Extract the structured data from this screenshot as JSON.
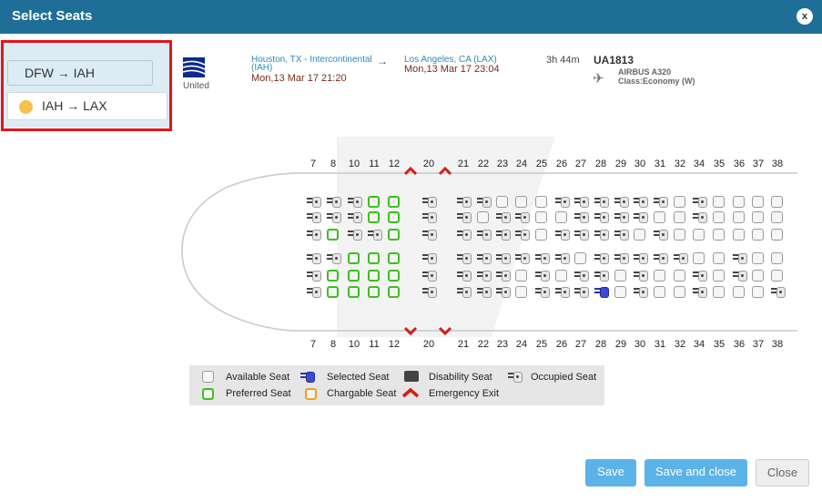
{
  "dialog": {
    "title": "Select Seats",
    "close_label": "x"
  },
  "legs": [
    {
      "label": "DFW → IAH"
    },
    {
      "label": "IAH → LAX"
    }
  ],
  "flight": {
    "airline": "United",
    "origin_city": "Houston, TX - Intercontinental",
    "origin_code": "(IAH)",
    "depart_time": "Mon,13 Mar 17 21:20",
    "arrow": "→",
    "dest_city": "Los Angeles, CA (LAX)",
    "arrive_time": "Mon,13 Mar 17 23:04",
    "duration": "3h 44m",
    "flight_number": "UA1813",
    "aircraft": "AIRBUS A320",
    "class": "Class:Economy (W)"
  },
  "rows": [
    "7",
    "8",
    "10",
    "11",
    "12",
    "20",
    "21",
    "22",
    "23",
    "24",
    "25",
    "26",
    "27",
    "28",
    "29",
    "30",
    "31",
    "32",
    "34",
    "35",
    "36",
    "37",
    "38"
  ],
  "legend": {
    "available": "Available Seat",
    "selected": "Selected Seat",
    "disability": "Disability Seat",
    "occupied": "Occupied Seat",
    "preferred": "Preferred Seat",
    "chargable": "Chargable Seat",
    "exit": "Emergency Exit"
  },
  "buttons": {
    "save": "Save",
    "save_close": "Save and close",
    "close": "Close"
  },
  "colors": {
    "titlebar": "#1f6e98",
    "preferred": "#3bbf1e",
    "selected": "#3c4bd0",
    "button": "#5cb3e8",
    "highlight": "#e3141b"
  }
}
